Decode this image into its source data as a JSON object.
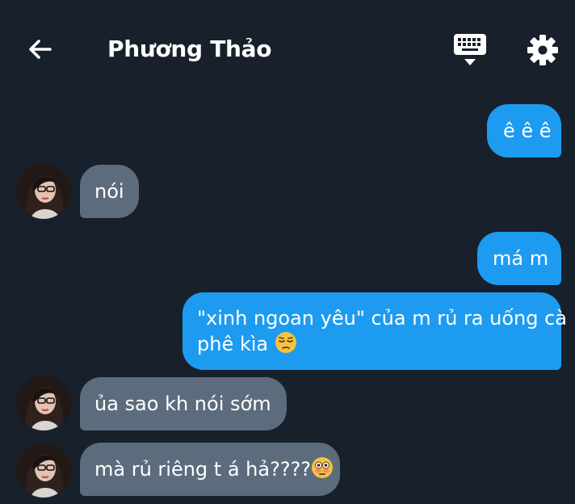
{
  "header": {
    "title": "Phương Thảo",
    "back_icon": "arrow-left-icon",
    "keyboard_icon": "keyboard-icon",
    "settings_icon": "gear-icon"
  },
  "messages": [
    {
      "direction": "out",
      "text": "ê ê ê"
    },
    {
      "direction": "in",
      "text": "nói"
    },
    {
      "direction": "out",
      "text": "má m"
    },
    {
      "direction": "out",
      "line1": "\"xinh ngoan yêu\" của m rủ ra uống cà",
      "line2": "phê kìa",
      "emoji": "pensive-face"
    },
    {
      "direction": "in",
      "text": "ủa sao kh nói sớm"
    },
    {
      "direction": "in",
      "text": "mà rủ riêng t á hả????",
      "emoji": "flushed-face"
    }
  ],
  "colors": {
    "background": "#17202b",
    "outgoing_bubble": "#1d9bf0",
    "incoming_bubble": "#5c6c7d",
    "text": "#ffffff"
  }
}
